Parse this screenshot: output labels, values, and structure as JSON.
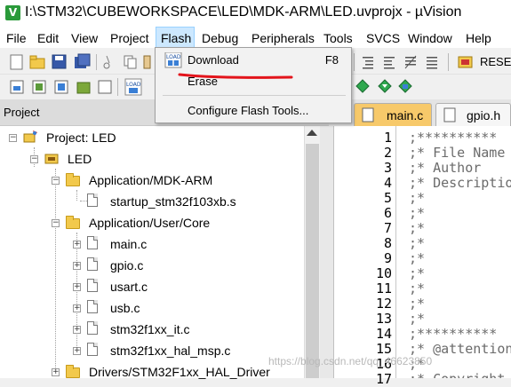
{
  "window": {
    "title": "I:\\STM32\\CUBEWORKSPACE\\LED\\MDK-ARM\\LED.uvprojx - µVision",
    "icon": "uvision-app-icon"
  },
  "menubar": {
    "items": [
      "File",
      "Edit",
      "View",
      "Project",
      "Flash",
      "Debug",
      "Peripherals",
      "Tools",
      "SVCS",
      "Window",
      "Help"
    ],
    "active": "Flash"
  },
  "toolbar": {
    "reset_label": "RESET"
  },
  "flash_menu": {
    "items": [
      {
        "label": "Download",
        "shortcut": "F8",
        "icon": "load-download-icon"
      },
      {
        "label": "Erase",
        "shortcut": ""
      },
      {
        "label": "Configure Flash Tools...",
        "shortcut": ""
      }
    ],
    "annotation_color": "#e3141b"
  },
  "project_pane": {
    "title": "Project",
    "tree": [
      {
        "label": "Project: LED",
        "type": "project"
      },
      {
        "label": "LED",
        "type": "target"
      },
      {
        "label": "Application/MDK-ARM",
        "type": "folder"
      },
      {
        "label": "startup_stm32f103xb.s",
        "type": "file"
      },
      {
        "label": "Application/User/Core",
        "type": "folder"
      },
      {
        "label": "main.c",
        "type": "file"
      },
      {
        "label": "gpio.c",
        "type": "file"
      },
      {
        "label": "usart.c",
        "type": "file"
      },
      {
        "label": "usb.c",
        "type": "file"
      },
      {
        "label": "stm32f1xx_it.c",
        "type": "file"
      },
      {
        "label": "stm32f1xx_hal_msp.c",
        "type": "file"
      },
      {
        "label": "Drivers/STM32F1xx_HAL_Driver",
        "type": "folder"
      }
    ]
  },
  "editor": {
    "tabs": [
      {
        "label": "main.c",
        "active": true
      },
      {
        "label": "gpio.h",
        "active": false
      }
    ],
    "lines": [
      {
        "n": "1",
        "code": ";**********"
      },
      {
        "n": "2",
        "code": ";* File Name"
      },
      {
        "n": "3",
        "code": ";* Author"
      },
      {
        "n": "4",
        "code": ";* Descriptio"
      },
      {
        "n": "5",
        "code": ";*"
      },
      {
        "n": "6",
        "code": ";*"
      },
      {
        "n": "7",
        "code": ";*"
      },
      {
        "n": "8",
        "code": ";*"
      },
      {
        "n": "9",
        "code": ";*"
      },
      {
        "n": "10",
        "code": ";*"
      },
      {
        "n": "11",
        "code": ";*"
      },
      {
        "n": "12",
        "code": ";*"
      },
      {
        "n": "13",
        "code": ";*"
      },
      {
        "n": "14",
        "code": ";**********"
      },
      {
        "n": "15",
        "code": ";* @attention"
      },
      {
        "n": "16",
        "code": ";*"
      },
      {
        "n": "17",
        "code": ";* Copyright"
      }
    ]
  },
  "watermark": "https://blog.csdn.net/qq_46623850"
}
